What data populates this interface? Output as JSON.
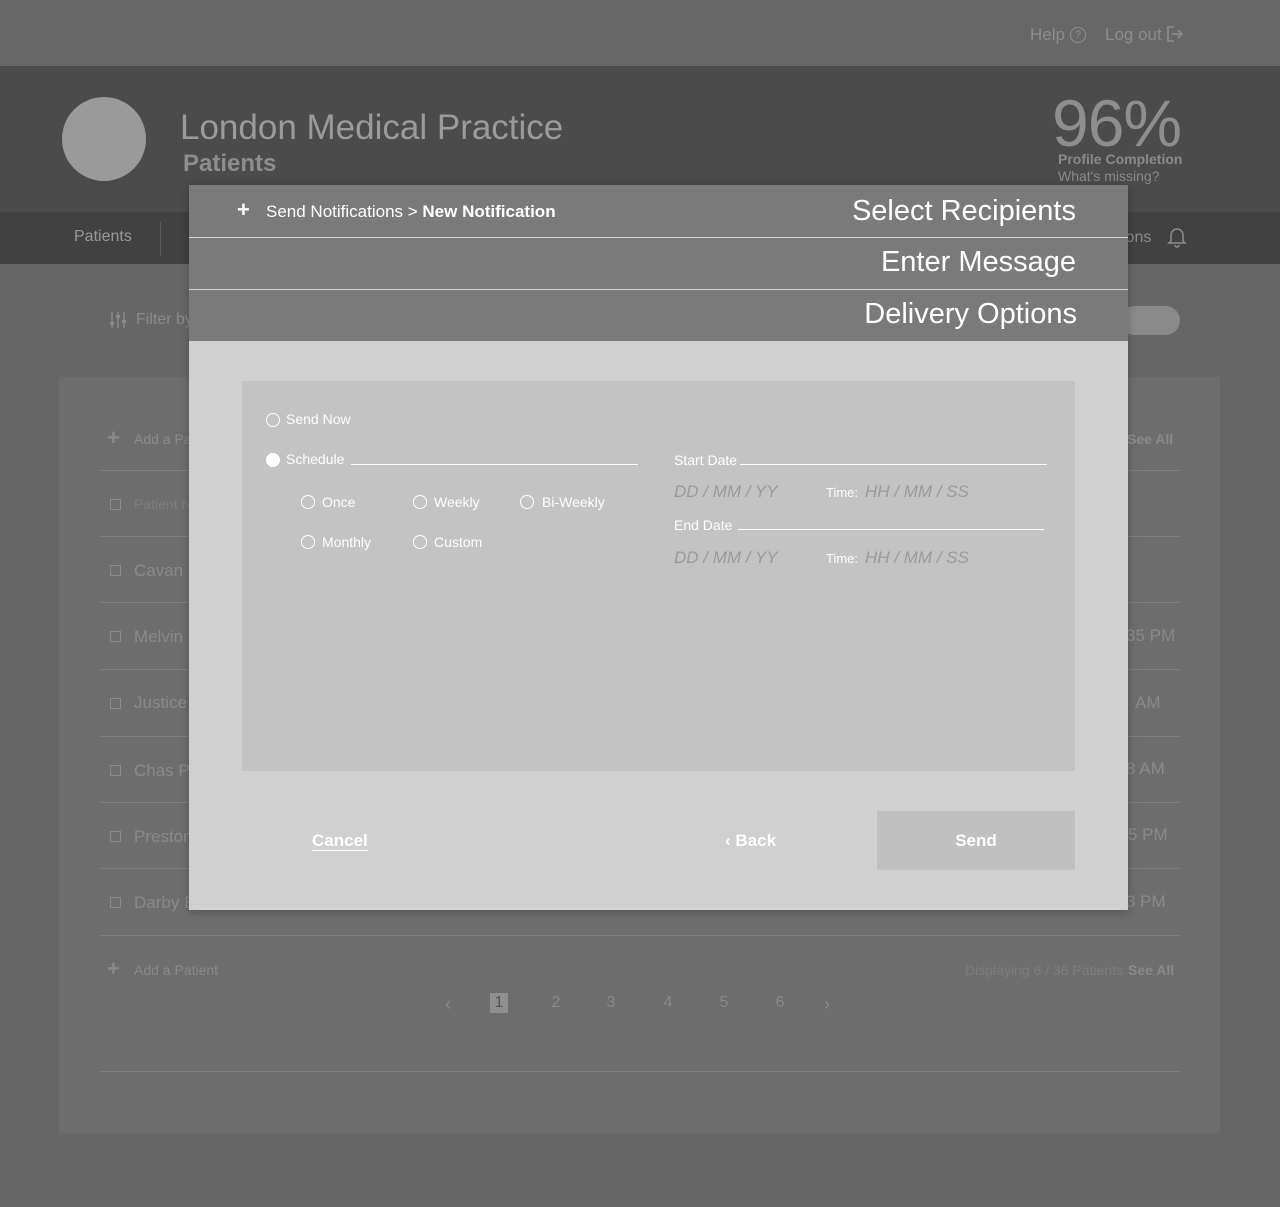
{
  "topbar": {
    "help": "Help",
    "help_icon_glyph": "?",
    "logout": "Log out"
  },
  "header": {
    "practice_name": "London Medical Practice",
    "subtitle": "Patients",
    "completion_percent": "96%",
    "completion_label": "Profile Completion",
    "completion_link": "What's missing?"
  },
  "nav": {
    "patients": "Patients",
    "notifications_fragment": "ions"
  },
  "filter": {
    "label": "Filter by"
  },
  "list": {
    "add_patient_top": "Add a Pa",
    "see_all": "See All",
    "column_patient_name": "Patient N",
    "rows": [
      {
        "name": "Cavan S",
        "time": ""
      },
      {
        "name": "Melvin I",
        "time": "35 PM"
      },
      {
        "name": "Justice",
        "time": "AM"
      },
      {
        "name": "Chas P",
        "time": "8 AM"
      },
      {
        "name": "Preston",
        "time": "5 PM"
      },
      {
        "name": "Darby E",
        "time": "3 PM"
      }
    ],
    "add_patient_bottom": "Add a Patient",
    "displaying": "Displaying 6 / 36 Patients.",
    "see_all_bottom": "See All"
  },
  "pagination": {
    "prev": "‹",
    "next": "›",
    "pages": [
      "1",
      "2",
      "3",
      "4",
      "5",
      "6"
    ],
    "current": "1"
  },
  "modal": {
    "breadcrumb_plus": "+",
    "breadcrumb_prefix": "Send Notifications > ",
    "breadcrumb_current": "New Notification",
    "steps": [
      "Select Recipients",
      "Enter Message",
      "Delivery Options"
    ],
    "send_now": "Send Now",
    "schedule": "Schedule",
    "frequency_options": [
      "Once",
      "Weekly",
      "Bi-Weekly",
      "Monthly",
      "Custom"
    ],
    "start_date_label": "Start Date",
    "end_date_label": "End Date",
    "date_placeholder": "DD / MM / YY",
    "time_label": "Time:",
    "time_placeholder": "HH / MM / SS",
    "cancel": "Cancel",
    "back": "Back",
    "back_chevron": "‹",
    "send": "Send"
  }
}
